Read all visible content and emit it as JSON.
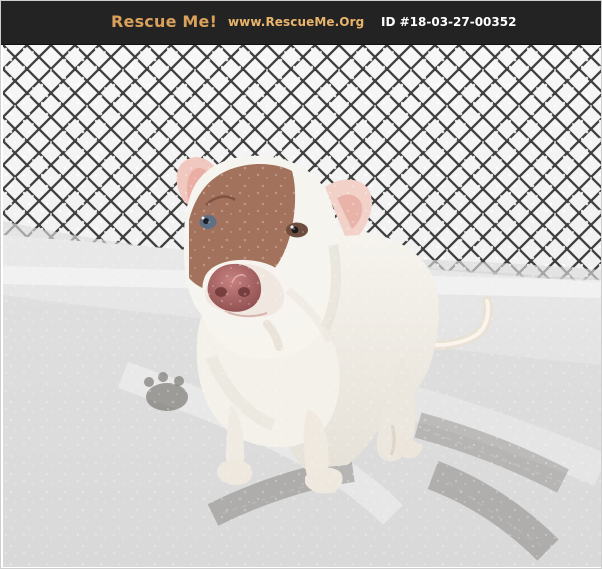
{
  "header": {
    "brand": "Rescue Me!",
    "site": "www.RescueMe.Org",
    "listing_id": "ID #18-03-27-00352"
  },
  "photo": {
    "colors": {
      "header_bg": "#232323",
      "brand_orange": "#d9a15a",
      "site_orange": "#e9b56c",
      "snow": "#f4f4f4",
      "fence_wire": "#202020",
      "dog_white": "#f3f0e8",
      "dog_patch": "#9f7461",
      "nose": "#9b5555"
    }
  }
}
